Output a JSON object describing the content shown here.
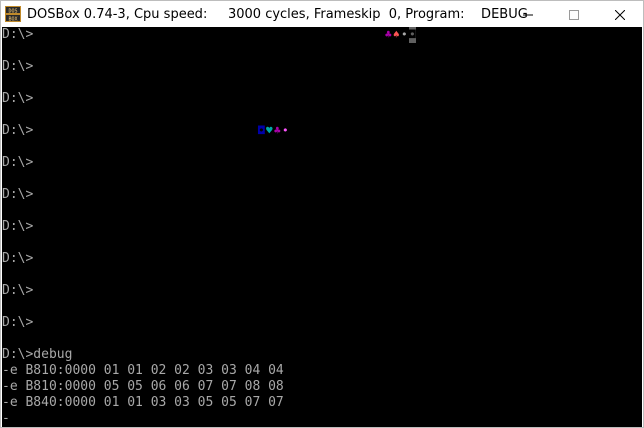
{
  "window": {
    "title": "DOSBox 0.74-3, Cpu speed:     3000 cycles, Frameskip  0, Program:    DEBUG",
    "icon": "dosbox-icon",
    "controls": [
      "minimize-icon",
      "maximize-icon",
      "close-icon"
    ]
  },
  "terminal": {
    "lines": [
      "D:\\>",
      "",
      "D:\\>",
      "",
      "D:\\>",
      "",
      "D:\\>",
      "",
      "D:\\>",
      "",
      "D:\\>",
      "",
      "D:\\>",
      "",
      "D:\\>",
      "",
      "D:\\>",
      "",
      "D:\\>",
      "",
      "D:\\>debug",
      "-e B810:0000 01 01 02 02 03 03 04 04",
      "-e B810:0000 05 05 06 06 07 07 08 08",
      "-e B840:0000 01 01 03 03 05 05 07 07",
      "-"
    ],
    "colored_glyphs_row1": [
      {
        "char": "♣",
        "color": "#a800a8"
      },
      {
        "char": "♠",
        "color": "#fc5454"
      },
      {
        "char": "•",
        "color": "#a8a8a8"
      },
      {
        "char": "◘",
        "color": "#ffffff"
      }
    ],
    "colored_glyphs_row4": [
      {
        "char": "◘",
        "color": "#0000a8"
      },
      {
        "char": "♥",
        "color": "#00a8a8"
      },
      {
        "char": "♣",
        "color": "#a800a8"
      },
      {
        "char": "•",
        "color": "#fc54fc"
      }
    ],
    "text_color": "#a8a8a8",
    "background": "#000000"
  }
}
